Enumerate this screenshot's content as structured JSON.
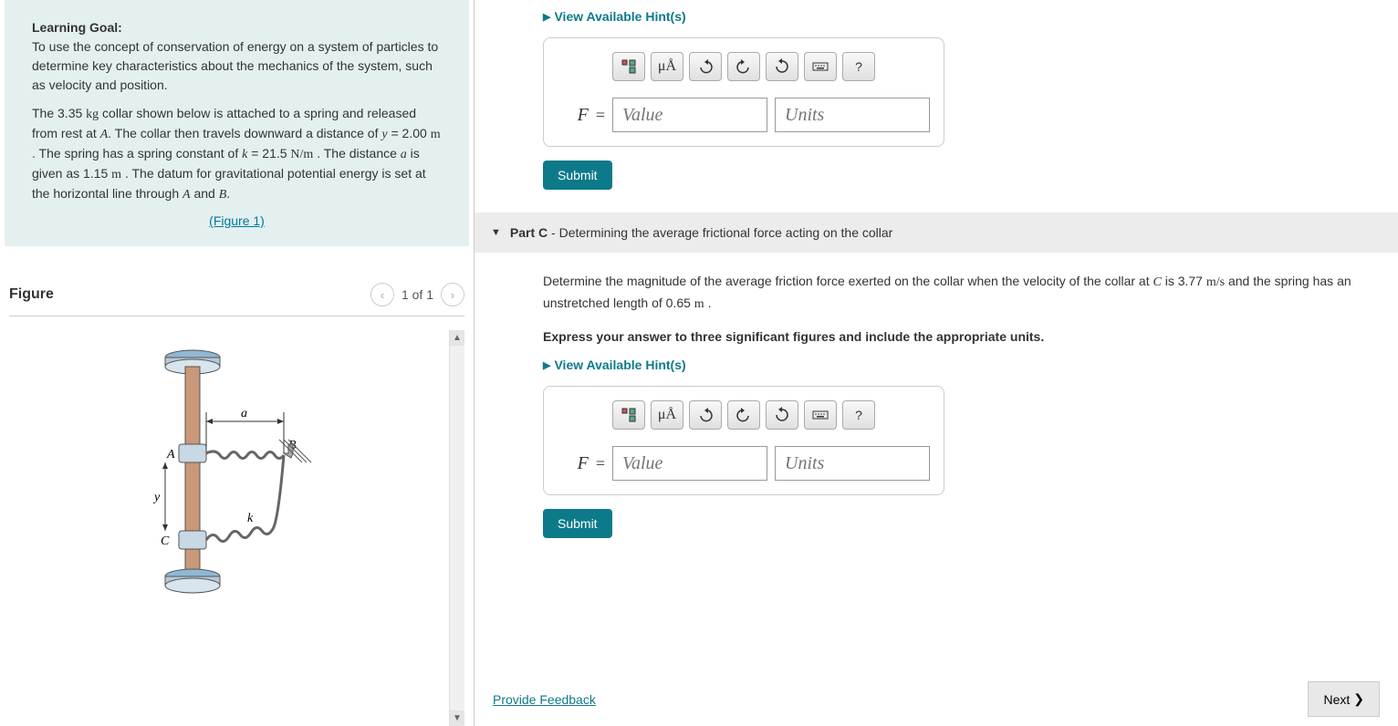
{
  "learning": {
    "heading": "Learning Goal:",
    "p1a": "To use the concept of conservation of energy on a system of particles to determine key characteristics about the mechanics of the system, such as velocity and position.",
    "p2a": "The 3.35 ",
    "p2unit1": "kg",
    "p2b": " collar shown below is attached to a spring and released from rest at ",
    "p2varA": "A",
    "p2c": ". The collar then travels downward a distance of ",
    "p2varY": "y",
    "p2d": " = 2.00 ",
    "p2unit2": "m",
    "p2e": " . The spring has a spring constant of ",
    "p2varK": "k",
    "p2f": " = 21.5 ",
    "p2unit3": "N/m",
    "p2g": " . The distance ",
    "p2varA2": "a",
    "p2h": " is given as 1.15 ",
    "p2unit4": "m",
    "p2i": " . The datum for gravitational potential energy is set at the horizontal line through ",
    "p2varA3": "A",
    "p2j": " and ",
    "p2varB": "B",
    "p2k": ".",
    "figlink": "(Figure 1)"
  },
  "figure": {
    "title": "Figure",
    "pager": "1 of 1",
    "labels": {
      "a": "a",
      "A": "A",
      "B": "B",
      "C": "C",
      "y": "y",
      "k": "k"
    }
  },
  "hints": "View Available Hint(s)",
  "toolbar": {
    "mu": "μÅ",
    "help": "?"
  },
  "answer": {
    "label": "F",
    "eq": "=",
    "value_ph": "Value",
    "units_ph": "Units"
  },
  "submit": "Submit",
  "partC": {
    "label": "Part C",
    "dash": " - ",
    "title": "Determining the average frictional force acting on the collar",
    "q1": "Determine the magnitude of the average friction force exerted on the collar when the velocity of the collar at ",
    "qvarC": "C",
    "q2": " is 3.77 ",
    "qunit1": "m/s",
    "q3": " and the spring has an unstretched length of 0.65 ",
    "qunit2": "m",
    "q4": " .",
    "instr": "Express your answer to three significant figures and include the appropriate units."
  },
  "feedback": "Provide Feedback",
  "next": "Next"
}
